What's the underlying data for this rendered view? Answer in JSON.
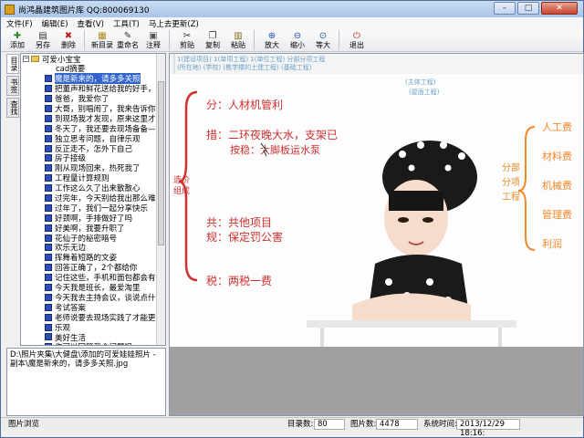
{
  "window": {
    "title": "尚鸿晶建筑图片库 QQ:800069130",
    "min": "–",
    "max": "□",
    "close": "✕"
  },
  "menu": [
    "文件(F)",
    "编辑(E)",
    "查看(V)",
    "工具(T)",
    "马上去更新(Z)"
  ],
  "toolbar": [
    {
      "label": "添加",
      "icon": "plus-icon",
      "glyph": "✚",
      "color": "#2a8a2a"
    },
    {
      "label": "另存",
      "icon": "save-as-icon",
      "glyph": "▤",
      "color": "#333"
    },
    {
      "label": "删除",
      "icon": "delete-icon",
      "glyph": "✖",
      "color": "#c02020"
    },
    {
      "label": "新目录",
      "icon": "new-folder-icon",
      "glyph": "▦",
      "color": "#b08a20"
    },
    {
      "label": "重命名",
      "icon": "rename-icon",
      "glyph": "✎",
      "color": "#333"
    },
    {
      "label": "注释",
      "icon": "note-icon",
      "glyph": "▣",
      "color": "#555"
    },
    {
      "label": "剪贴",
      "icon": "cut-icon",
      "glyph": "✂",
      "color": "#333"
    },
    {
      "label": "复制",
      "icon": "copy-icon",
      "glyph": "❐",
      "color": "#333"
    },
    {
      "label": "粘贴",
      "icon": "paste-icon",
      "glyph": "▥",
      "color": "#8a6a20"
    },
    {
      "label": "放大",
      "icon": "zoom-in-icon",
      "glyph": "⊕",
      "color": "#1a50a0"
    },
    {
      "label": "缩小",
      "icon": "zoom-out-icon",
      "glyph": "⊖",
      "color": "#1a50a0"
    },
    {
      "label": "等大",
      "icon": "actual-size-icon",
      "glyph": "⊙",
      "color": "#1a50a0"
    },
    {
      "label": "退出",
      "icon": "exit-icon",
      "glyph": "⏻",
      "color": "#c02020"
    }
  ],
  "sidetabs": [
    "目录",
    "书签",
    "查找"
  ],
  "tree": {
    "root": "可爱小宝宝",
    "items": [
      "cad摘要",
      "魔是新来的，请多多关照",
      "把董声和鲜花送给我的好手，爸",
      "爸爸，我爱你了",
      "大哥，别唱闹了，我来告诉你怎",
      "到现场我才发现，原来这里才是",
      "冬天了，我还要去现场备备——",
      "独立思考问题，自律乐观",
      "反正走不，怎外下自己",
      "房子接级",
      "刚从现场回来，热死我了",
      "工程量计算规则",
      "工作这么久了出来散散心",
      "过完年，今天别给我出那么难的",
      "过年了，我们一起分享快乐",
      "好颈啊，手排做好了吗",
      "好美啊，我要升职了",
      "花仙子的秘密暗号",
      "欢乐无边",
      "挥舞着短路的文姿",
      "回答正确了，2个都给你",
      "记住这些，手机和面包都会有的",
      "今天我是班长，最爱淘里",
      "今天我去主持会议，谈说点什么好",
      "考试答案",
      "老师说要去现场实践了才能更",
      "乐观",
      "美好生活",
      "你可以回答我个问题吗",
      "你可以出现的"
    ]
  },
  "filepath": "D:\\照片夹集\\大健盘\\添加的可爱娃娃照片 - 副本\\魔是新来的，请多多关照.jpg",
  "photo": {
    "left_notes": {
      "line1": "分：人材机管利",
      "line2": "措：二环夜晚大水，支架已",
      "line3": "按稳：大脚板运水泵",
      "line4": "共：共他项目",
      "line5": "规：保定罚公害",
      "line6": "税：两税一费",
      "side_label": "造价\n组成"
    },
    "header_strip": "1(建设项目)    1(单项工程)    1(单位工程)    分部分项工程",
    "header_strip2": "(所在地)     (学校)       (教学楼的土建工程)      (基础工程)",
    "header_strip3": "(主体工程)",
    "header_strip4": "(屋面工程)",
    "right_group_label": "分部\n分项\n工程",
    "right_items": [
      "人工费",
      "材料费",
      "机械费",
      "管理费",
      "利润"
    ]
  },
  "status": {
    "left": "图片浏览",
    "dir_label": "目录数:",
    "dir_value": "80",
    "img_label": "图片数:",
    "img_value": "4478",
    "time_label": "系统时间:",
    "time_value": "2013/12/29 18:16:"
  }
}
